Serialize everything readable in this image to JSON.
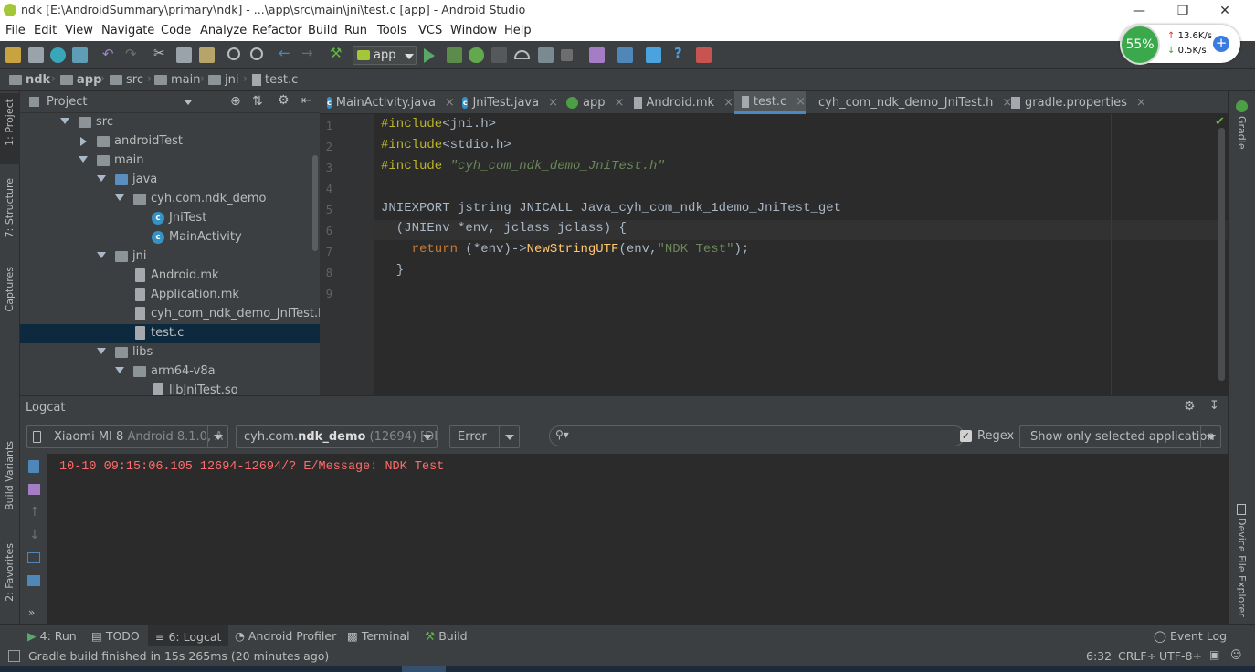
{
  "window": {
    "title": "ndk [E:\\AndroidSummary\\primary\\ndk] - ...\\app\\src\\main\\jni\\test.c [app] - Android Studio"
  },
  "menu": [
    "File",
    "Edit",
    "View",
    "Navigate",
    "Code",
    "Analyze",
    "Refactor",
    "Build",
    "Run",
    "Tools",
    "VCS",
    "Window",
    "Help"
  ],
  "toolbar": {
    "run_config": "app"
  },
  "breadcrumb": [
    "ndk",
    "app",
    "src",
    "main",
    "jni",
    "test.c"
  ],
  "project_panel": {
    "view": "Project",
    "tree": [
      {
        "label": "src",
        "type": "folder",
        "expanded": true
      },
      {
        "label": "androidTest",
        "type": "folder",
        "expanded": false
      },
      {
        "label": "main",
        "type": "folder",
        "expanded": true
      },
      {
        "label": "java",
        "type": "folder-blue",
        "expanded": true
      },
      {
        "label": "cyh.com.ndk_demo",
        "type": "package",
        "expanded": true
      },
      {
        "label": "JniTest",
        "type": "class"
      },
      {
        "label": "MainActivity",
        "type": "class"
      },
      {
        "label": "jni",
        "type": "folder",
        "expanded": true
      },
      {
        "label": "Android.mk",
        "type": "file"
      },
      {
        "label": "Application.mk",
        "type": "file"
      },
      {
        "label": "cyh_com_ndk_demo_JniTest.h",
        "type": "file"
      },
      {
        "label": "test.c",
        "type": "file",
        "selected": true
      },
      {
        "label": "libs",
        "type": "folder",
        "expanded": true
      },
      {
        "label": "arm64-v8a",
        "type": "folder",
        "expanded": true
      },
      {
        "label": "libJniTest.so",
        "type": "file"
      }
    ]
  },
  "tabs": [
    "MainActivity.java",
    "JniTest.java",
    "app",
    "Android.mk",
    "test.c",
    "cyh_com_ndk_demo_JniTest.h",
    "gradle.properties"
  ],
  "active_tab": "test.c",
  "editor": {
    "line_numbers": [
      "1",
      "2",
      "3",
      "4",
      "5",
      "6",
      "7",
      "8",
      "9"
    ],
    "lines": {
      "l1_pp": "#include",
      "l1_rest": "<jni.h>",
      "l2_pp": "#include",
      "l2_rest": "<stdio.h>",
      "l3_pp": "#include ",
      "l3_str": "\"cyh_com_ndk_demo_JniTest.h\"",
      "l5": "JNIEXPORT jstring JNICALL Java_cyh_com_ndk_1demo_JniTest_get",
      "l6": "  (JNIEnv *env, jclass jclass) {",
      "l7_kw": "    return ",
      "l7_a": "(*env)->",
      "l7_fn": "NewStringUTF",
      "l7_b": "(env,",
      "l7_str": "\"NDK Test\"",
      "l7_c": ");",
      "l8": "  }"
    }
  },
  "logcat": {
    "title": "Logcat",
    "device": "Xiaomi MI 8",
    "device_detail": "Android 8.1.0, A",
    "process": "cyh.com.",
    "process_bold": "ndk_demo",
    "process_detail": " (12694) [DE",
    "level": "Error",
    "regex_label": "Regex",
    "filter": "Show only selected application",
    "lines": [
      "10-10 09:15:06.105 12694-12694/? E/Message: NDK Test"
    ]
  },
  "left_strip": [
    "1: Project",
    "7: Structure",
    "Captures",
    "Build Variants",
    "2: Favorites"
  ],
  "right_strip": [
    "Gradle",
    "Device File Explorer"
  ],
  "bottom_tools": [
    {
      "label": "4: Run"
    },
    {
      "label": "TODO"
    },
    {
      "label": "6: Logcat",
      "active": true
    },
    {
      "label": "Android Profiler"
    },
    {
      "label": "Terminal"
    },
    {
      "label": "Build"
    }
  ],
  "event_log": "Event Log",
  "status": {
    "message": "Gradle build finished in 15s 265ms (20 minutes ago)",
    "position": "6:32",
    "line_sep": "CRLF÷",
    "encoding": "UTF-8÷"
  },
  "net_widget": {
    "percent": "55%",
    "up": "13.6K/s",
    "down": "0.5K/s"
  },
  "colors": {
    "accent": "#4a88c7",
    "editor_bg": "#2b2b2b",
    "error": "#ff6b68"
  }
}
